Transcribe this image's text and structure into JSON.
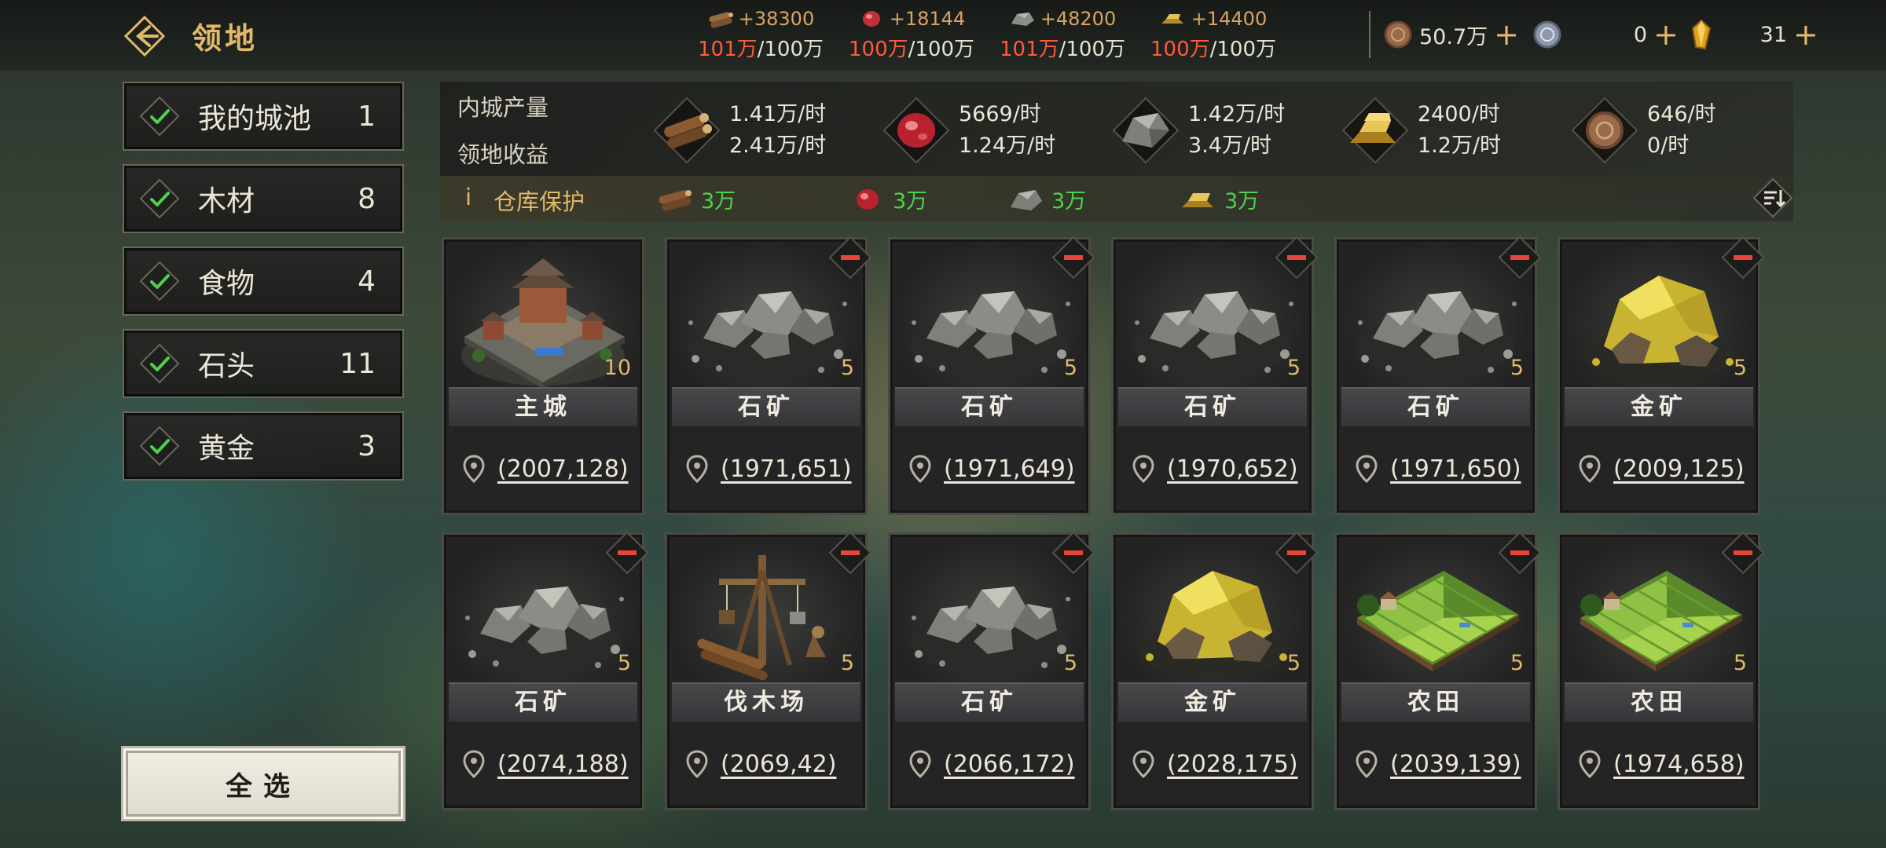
{
  "header": {
    "title": "领地",
    "resource_caps": [
      {
        "icon": "wood-icon",
        "gain": "+38300",
        "current": "101万",
        "max": "/100万"
      },
      {
        "icon": "meat-icon",
        "gain": "+18144",
        "current": "100万",
        "max": "/100万"
      },
      {
        "icon": "stone-icon",
        "gain": "+48200",
        "current": "101万",
        "max": "/100万"
      },
      {
        "icon": "gold-icon",
        "gain": "+14400",
        "current": "100万",
        "max": "/100万"
      }
    ],
    "currencies": [
      {
        "icon": "copper-coin-icon",
        "value": "50.7万"
      },
      {
        "icon": "silver-coin-icon",
        "value": "0"
      },
      {
        "icon": "crystal-icon",
        "value": "31"
      }
    ]
  },
  "filters": [
    {
      "label": "我的城池",
      "count": "1"
    },
    {
      "label": "木材",
      "count": "8"
    },
    {
      "label": "食物",
      "count": "4"
    },
    {
      "label": "石头",
      "count": "11"
    },
    {
      "label": "黄金",
      "count": "3"
    }
  ],
  "select_all": "全选",
  "production": {
    "inner_label": "内城产量",
    "territory_label": "领地收益",
    "items": [
      {
        "icon": "wood-icon",
        "inner": "1.41万/时",
        "territory": "2.41万/时"
      },
      {
        "icon": "meat-icon",
        "inner": "5669/时",
        "territory": "1.24万/时"
      },
      {
        "icon": "stone-icon",
        "inner": "1.42万/时",
        "territory": "3.4万/时"
      },
      {
        "icon": "gold-icon",
        "inner": "2400/时",
        "territory": "1.2万/时"
      },
      {
        "icon": "copper-coin-icon",
        "inner": "646/时",
        "territory": "0/时"
      }
    ]
  },
  "warehouse": {
    "info": "i",
    "label": "仓库保护",
    "items": [
      {
        "icon": "wood-icon",
        "value": "3万"
      },
      {
        "icon": "meat-icon",
        "value": "3万"
      },
      {
        "icon": "stone-icon",
        "value": "3万"
      },
      {
        "icon": "gold-icon",
        "value": "3万"
      }
    ]
  },
  "territories": [
    {
      "type": "city",
      "name": "主城",
      "level": "10",
      "coord": "(2007,128)",
      "removable": false
    },
    {
      "type": "stone",
      "name": "石矿",
      "level": "5",
      "coord": "(1971,651)",
      "removable": true
    },
    {
      "type": "stone",
      "name": "石矿",
      "level": "5",
      "coord": "(1971,649)",
      "removable": true
    },
    {
      "type": "stone",
      "name": "石矿",
      "level": "5",
      "coord": "(1970,652)",
      "removable": true
    },
    {
      "type": "stone",
      "name": "石矿",
      "level": "5",
      "coord": "(1971,650)",
      "removable": true
    },
    {
      "type": "gold",
      "name": "金矿",
      "level": "5",
      "coord": "(2009,125)",
      "removable": true
    },
    {
      "type": "stone",
      "name": "石矿",
      "level": "5",
      "coord": "(2074,188)",
      "removable": true
    },
    {
      "type": "lumber",
      "name": "伐木场",
      "level": "5",
      "coord": "(2069,42)",
      "removable": true
    },
    {
      "type": "stone",
      "name": "石矿",
      "level": "5",
      "coord": "(2066,172)",
      "removable": true
    },
    {
      "type": "gold",
      "name": "金矿",
      "level": "5",
      "coord": "(2028,175)",
      "removable": true
    },
    {
      "type": "farm",
      "name": "农田",
      "level": "5",
      "coord": "(2039,139)",
      "removable": true
    },
    {
      "type": "farm",
      "name": "农田",
      "level": "5",
      "coord": "(1974,658)",
      "removable": true
    }
  ]
}
